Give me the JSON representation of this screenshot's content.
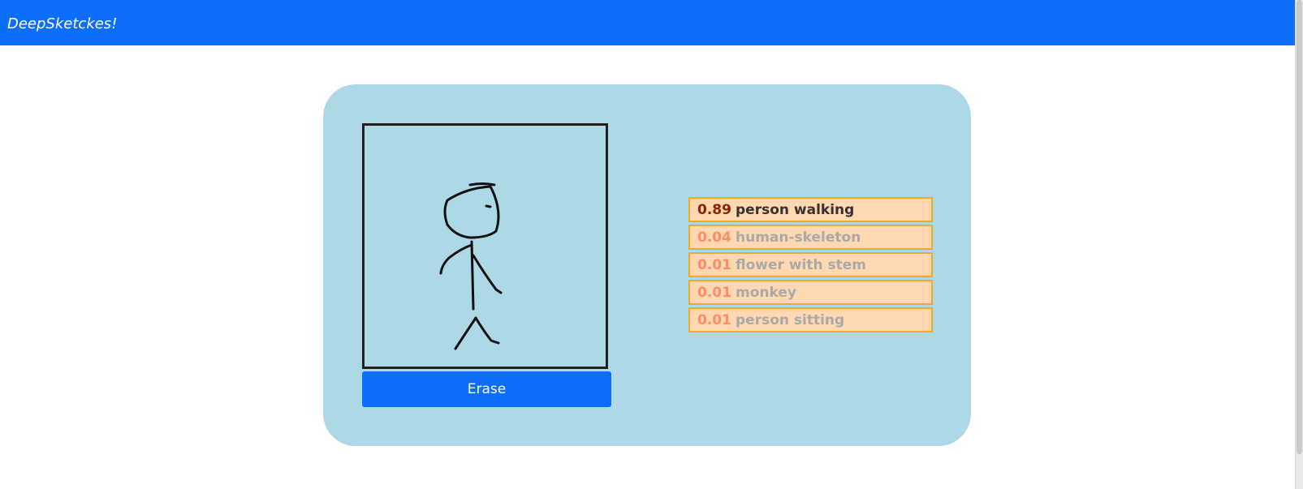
{
  "navbar": {
    "brand": "DeepSketckes!",
    "color": "#0d6efd"
  },
  "panel": {
    "background": "#add8e6"
  },
  "canvas": {
    "drawing": "stick-figure-person-walking"
  },
  "erase_button": {
    "label": "Erase"
  },
  "predictions": [
    {
      "score": "0.89",
      "label": "person walking"
    },
    {
      "score": "0.04",
      "label": "human-skeleton"
    },
    {
      "score": "0.01",
      "label": "flower with stem"
    },
    {
      "score": "0.01",
      "label": "monkey"
    },
    {
      "score": "0.01",
      "label": "person sitting"
    }
  ]
}
